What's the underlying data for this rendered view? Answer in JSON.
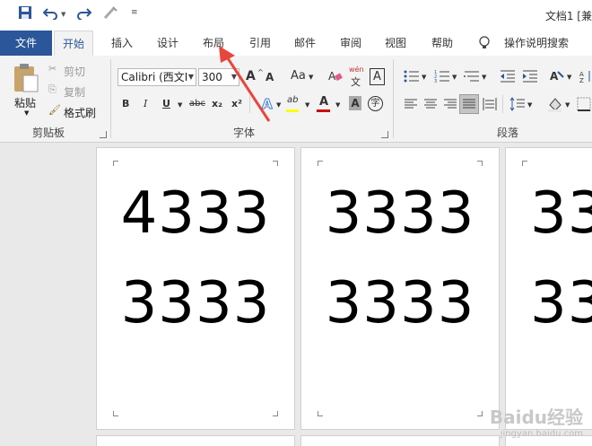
{
  "title_bar": {
    "document_title": "文档1 [兼"
  },
  "tabs": [
    {
      "label": "文件",
      "name": "tab-file"
    },
    {
      "label": "开始",
      "name": "tab-home"
    },
    {
      "label": "插入",
      "name": "tab-insert"
    },
    {
      "label": "设计",
      "name": "tab-design"
    },
    {
      "label": "布局",
      "name": "tab-layout"
    },
    {
      "label": "引用",
      "name": "tab-references"
    },
    {
      "label": "邮件",
      "name": "tab-mailings"
    },
    {
      "label": "审阅",
      "name": "tab-review"
    },
    {
      "label": "视图",
      "name": "tab-view"
    },
    {
      "label": "帮助",
      "name": "tab-help"
    }
  ],
  "tell_me": "操作说明搜索",
  "clipboard": {
    "paste": "粘贴",
    "cut": "剪切",
    "copy": "复制",
    "format_painter": "格式刷",
    "group_label": "剪贴板"
  },
  "font": {
    "font_name": "Calibri (西文I",
    "font_size": "300",
    "group_label": "字体",
    "grow": "A",
    "shrink": "A",
    "case": "Aa",
    "phonetic_top": "wén",
    "phonetic_bottom": "文",
    "border_char": "A",
    "bold": "B",
    "italic": "I",
    "underline": "U",
    "strike": "abc",
    "subscript": "x₂",
    "superscript": "x²",
    "highlight": "ab",
    "font_color": "A",
    "shading": "A",
    "enclose": "字"
  },
  "paragraph": {
    "group_label": "段落"
  },
  "pages": [
    {
      "line1": "4333",
      "line2": "3333"
    },
    {
      "line1": "3333",
      "line2": "3333"
    },
    {
      "line1": "33",
      "line2": "33"
    }
  ],
  "watermark": {
    "text": "Baidu经验",
    "sub": "jingyan.baidu.com"
  },
  "colors": {
    "file_tab": "#2b579a",
    "accent": "#2b579a",
    "arrow": "#e8453c",
    "font_color_bar": "#d00000",
    "highlight_bar": "#ffff00"
  }
}
